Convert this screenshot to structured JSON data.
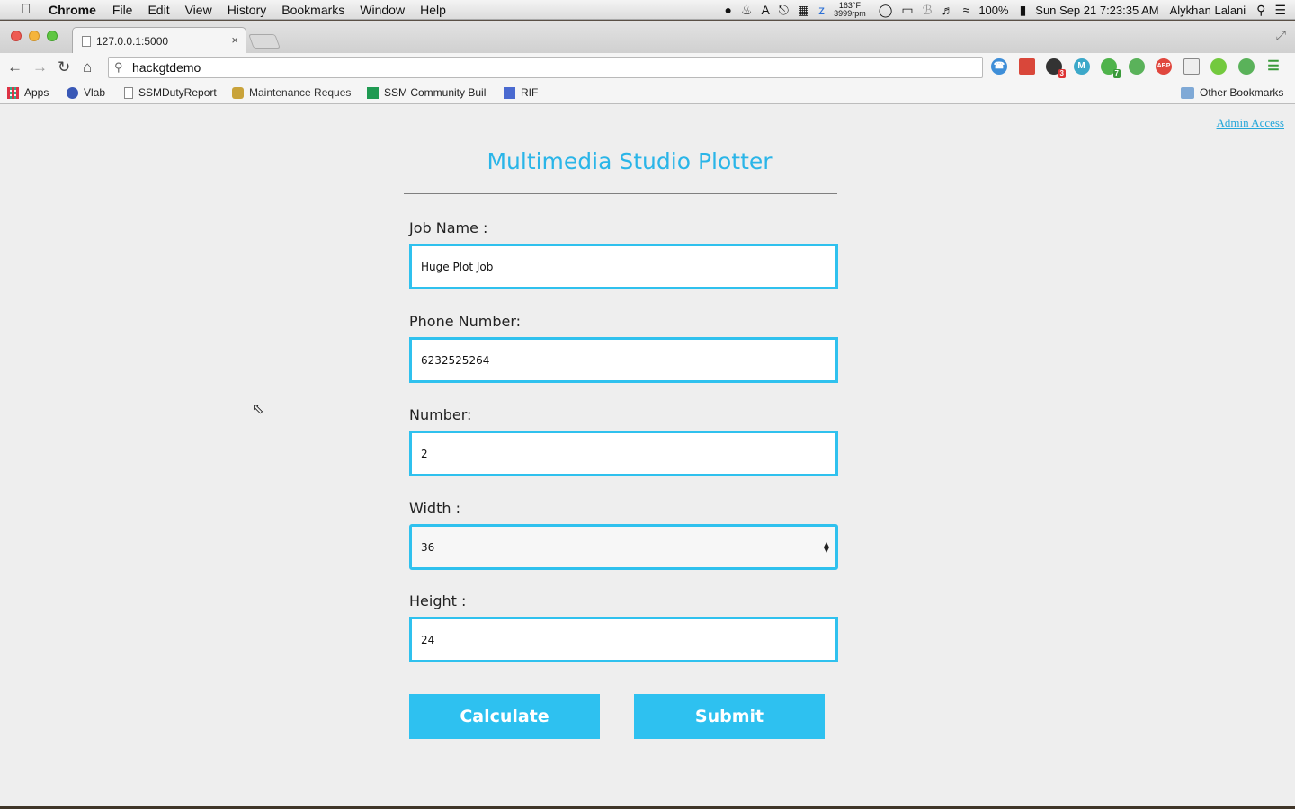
{
  "menubar": {
    "app_name": "Chrome",
    "menus": [
      "File",
      "Edit",
      "View",
      "History",
      "Bookmarks",
      "Window",
      "Help"
    ],
    "temperature": "163°F",
    "fan_speed": "3999rpm",
    "battery": "100%",
    "clock": "Sun Sep 21  7:23:35 AM",
    "user": "Alykhan Lalani"
  },
  "browser": {
    "tab_title": "127.0.0.1:5000",
    "omnibox_text": "hackgtdemo",
    "bookmarks": [
      {
        "label": "Apps",
        "icon": "apps-grid-icon"
      },
      {
        "label": "Vlab",
        "icon": "vlab-icon"
      },
      {
        "label": "SSMDutyReport",
        "icon": "document-icon"
      },
      {
        "label": "Maintenance Reques",
        "icon": "bee-icon"
      },
      {
        "label": "SSM Community Buil",
        "icon": "sheets-icon"
      },
      {
        "label": "RIF",
        "icon": "bookmark-blue-icon"
      }
    ],
    "other_bookmarks": "Other Bookmarks",
    "extension_badges": {
      "red_badge": "3",
      "green_badge": "7"
    }
  },
  "page": {
    "admin_link": "Admin Access",
    "title": "Multimedia Studio Plotter",
    "fields": {
      "job_name": {
        "label": "Job Name :",
        "value": "Huge Plot Job"
      },
      "phone": {
        "label": "Phone Number:",
        "value": "6232525264"
      },
      "number": {
        "label": "Number:",
        "value": "2"
      },
      "width": {
        "label": "Width :",
        "value": "36"
      },
      "height": {
        "label": "Height :",
        "value": "24"
      }
    },
    "calculate_label": "Calculate",
    "submit_label": "Submit"
  },
  "colors": {
    "accent": "#2ec1f0",
    "title": "#2ab5e8",
    "link": "#25a7da"
  }
}
